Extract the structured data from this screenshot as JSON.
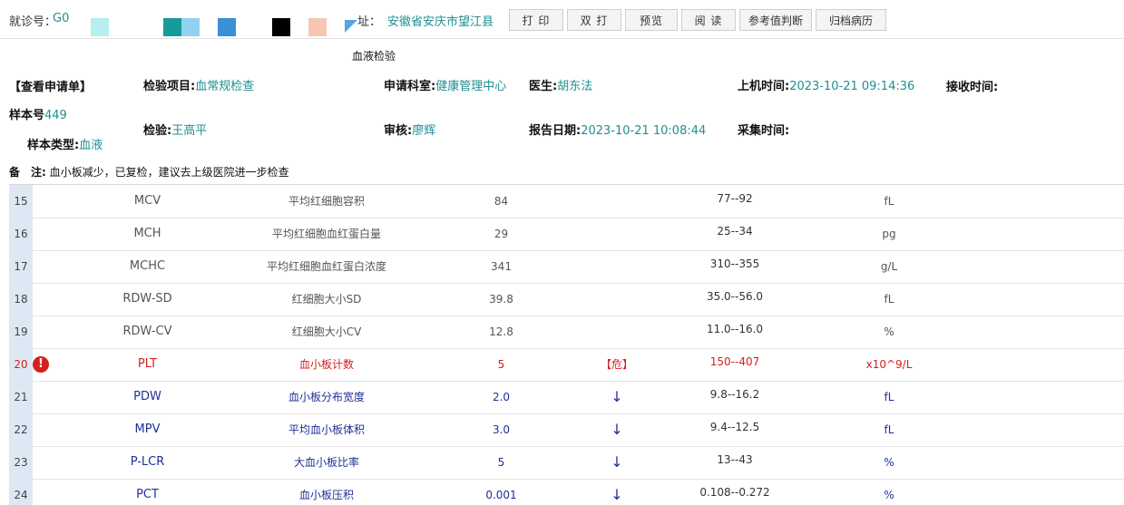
{
  "topbar": {
    "visit_label": "就诊号：",
    "visit_value": "G0",
    "address_label": "址：",
    "address_value": "安徽省安庆市望江县",
    "buttons": [
      "打 印",
      "双 打",
      "预览",
      "阅 读",
      "参考值判断",
      "归档病历"
    ],
    "colors": {
      "swatch1": "#b7eef0",
      "swatch2": "#179a9a",
      "swatch3": "#8fd3f0",
      "swatch4": "#3a8fd6",
      "swatch5": "#000000",
      "swatch6": "#f6c6b0",
      "swatch7": "#5aa4e0"
    }
  },
  "report": {
    "title": "血液检验",
    "view_request": "【查看申请单】",
    "item_label": "检验项目:",
    "item_value": "血常规检查",
    "dept_label": "申请科室:",
    "dept_value": "健康管理中心",
    "doctor_label": "医生:",
    "doctor_value": "胡东法",
    "machine_time_label": "上机时间:",
    "machine_time_value": "2023-10-21 09:14:36",
    "receive_time_label": "接收时间:",
    "sample_no_label": "样本号",
    "sample_no_value": "449",
    "tester_label": "检验:",
    "tester_value": "王高平",
    "reviewer_label": "审核:",
    "reviewer_value": "廖辉",
    "report_date_label": "报告日期:",
    "report_date_value": "2023-10-21 10:08:44",
    "collect_time_label": "采集时间:",
    "sample_type_label": "样本类型:",
    "sample_type_value": "血液",
    "notes_label": "备　注:",
    "notes_value": "血小板减少，已复检，建议去上级医院进一步检查"
  },
  "rows": [
    {
      "no": "15",
      "abbr": "MCV",
      "name": "平均红细胞容积",
      "result": "84",
      "flag": "",
      "ref": "77--92",
      "unit": "fL",
      "status": "normal"
    },
    {
      "no": "16",
      "abbr": "MCH",
      "name": "平均红细胞血红蛋白量",
      "result": "29",
      "flag": "",
      "ref": "25--34",
      "unit": "pg",
      "status": "normal"
    },
    {
      "no": "17",
      "abbr": "MCHC",
      "name": "平均红细胞血红蛋白浓度",
      "result": "341",
      "flag": "",
      "ref": "310--355",
      "unit": "g/L",
      "status": "normal"
    },
    {
      "no": "18",
      "abbr": "RDW-SD",
      "name": "红细胞大小SD",
      "result": "39.8",
      "flag": "",
      "ref": "35.0--56.0",
      "unit": "fL",
      "status": "normal"
    },
    {
      "no": "19",
      "abbr": "RDW-CV",
      "name": "红细胞大小CV",
      "result": "12.8",
      "flag": "",
      "ref": "11.0--16.0",
      "unit": "%",
      "status": "normal"
    },
    {
      "no": "20",
      "abbr": "PLT",
      "name": "血小板计数",
      "result": "5",
      "flag": "【危】",
      "ref": "150--407",
      "unit": "x10^9/L",
      "status": "alarm",
      "icon": "warning-icon"
    },
    {
      "no": "21",
      "abbr": "PDW",
      "name": "血小板分布宽度",
      "result": "2.0",
      "flag": "↓",
      "ref": "9.8--16.2",
      "unit": "fL",
      "status": "low"
    },
    {
      "no": "22",
      "abbr": "MPV",
      "name": "平均血小板体积",
      "result": "3.0",
      "flag": "↓",
      "ref": "9.4--12.5",
      "unit": "fL",
      "status": "low"
    },
    {
      "no": "23",
      "abbr": "P-LCR",
      "name": "大血小板比率",
      "result": "5",
      "flag": "↓",
      "ref": "13--43",
      "unit": "%",
      "status": "low"
    },
    {
      "no": "24",
      "abbr": "PCT",
      "name": "血小板压积",
      "result": "0.001",
      "flag": "↓",
      "ref": "0.108--0.272",
      "unit": "%",
      "status": "low"
    }
  ]
}
